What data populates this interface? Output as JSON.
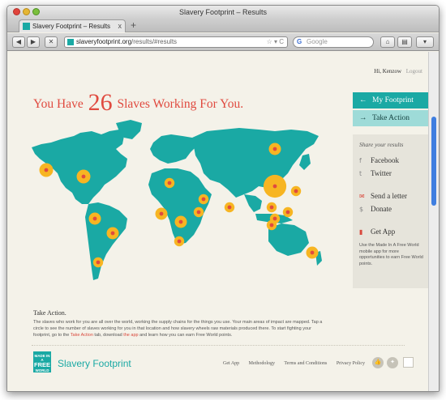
{
  "window": {
    "title": "Slavery Footprint – Results"
  },
  "tab": {
    "label": "Slavery Footprint – Results",
    "close": "x"
  },
  "newtab": "+",
  "toolbar": {
    "back": "◀",
    "forward": "▶",
    "stop": "✕",
    "url_domain": "slaveryfootprint.org",
    "url_path": "/results/#results",
    "url_controls": "☆ ▾ C",
    "search_engine": "G",
    "search_placeholder": "Google",
    "home": "⌂",
    "bookmarks": "▤",
    "menu": "▾"
  },
  "user": {
    "greeting": "Hi, Kenzow",
    "logout": "Logout"
  },
  "headline": {
    "prefix": "You Have",
    "count": "26",
    "suffix": "Slaves Working For You."
  },
  "sidebar": {
    "my_footprint": "My Footprint",
    "take_action": "Take Action",
    "share_title": "Share your results",
    "facebook": "Facebook",
    "twitter": "Twitter",
    "send_letter": "Send a letter",
    "donate": "Donate",
    "get_app": "Get App",
    "app_desc": "Use the Made In A Free World mobile app for more opportunities to earn Free World points."
  },
  "take_action": {
    "title": "Take Action.",
    "body1": "The slaves who work for you are all over the world, working the supply chains for the things you use. Your main areas of impact are mapped. Tap a circle to see the number of slaves working for you in that location and how slavery wheels raw materials produced there. To start fighting your footprint, go to the ",
    "link1": "Take Action",
    "body2": " tab, download ",
    "link2": "the app",
    "body3": " and learn how you can earn Free World points."
  },
  "footer": {
    "logo_small": "MADE IN A",
    "logo_big": "FREE",
    "logo_bottom": "WORLD",
    "brand": "Slavery Footprint",
    "nav": [
      "Get App",
      "Methodology",
      "Terms and Conditions",
      "Privacy Policy"
    ],
    "like": "👍",
    "tweet": "✦"
  },
  "colors": {
    "teal": "#1aa9a4",
    "light_teal": "#9edbd8",
    "red": "#e04a3f",
    "gold": "#f7b522",
    "background": "#f4f2e9"
  },
  "map": {
    "impact_points": [
      {
        "region": "Western North America",
        "magnitude": 3
      },
      {
        "region": "Eastern North America",
        "magnitude": 3
      },
      {
        "region": "Northern South America",
        "magnitude": 2
      },
      {
        "region": "Central South America",
        "magnitude": 2
      },
      {
        "region": "Southern South America",
        "magnitude": 1
      },
      {
        "region": "North Africa",
        "magnitude": 1
      },
      {
        "region": "West Africa",
        "magnitude": 2
      },
      {
        "region": "Central Africa",
        "magnitude": 2
      },
      {
        "region": "Southern Africa",
        "magnitude": 1
      },
      {
        "region": "Middle East",
        "magnitude": 1
      },
      {
        "region": "East Africa",
        "magnitude": 1
      },
      {
        "region": "India",
        "magnitude": 1
      },
      {
        "region": "Northern Russia",
        "magnitude": 2
      },
      {
        "region": "China",
        "magnitude": 12
      },
      {
        "region": "Korea",
        "magnitude": 1
      },
      {
        "region": "Southeast Asia",
        "magnitude": 1
      },
      {
        "region": "Indochina",
        "magnitude": 1
      },
      {
        "region": "Indonesia",
        "magnitude": 1
      },
      {
        "region": "Philippines",
        "magnitude": 1
      },
      {
        "region": "Australia",
        "magnitude": 2
      }
    ]
  }
}
